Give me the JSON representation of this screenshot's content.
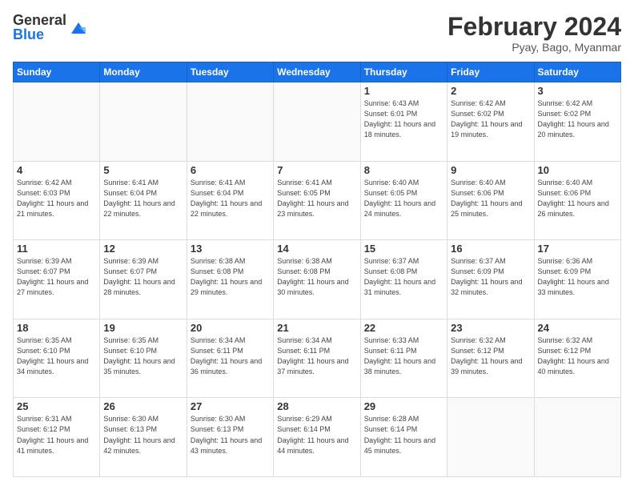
{
  "logo": {
    "general": "General",
    "blue": "Blue"
  },
  "header": {
    "month": "February 2024",
    "location": "Pyay, Bago, Myanmar"
  },
  "weekdays": [
    "Sunday",
    "Monday",
    "Tuesday",
    "Wednesday",
    "Thursday",
    "Friday",
    "Saturday"
  ],
  "weeks": [
    [
      {
        "day": "",
        "info": ""
      },
      {
        "day": "",
        "info": ""
      },
      {
        "day": "",
        "info": ""
      },
      {
        "day": "",
        "info": ""
      },
      {
        "day": "1",
        "info": "Sunrise: 6:43 AM\nSunset: 6:01 PM\nDaylight: 11 hours\nand 18 minutes."
      },
      {
        "day": "2",
        "info": "Sunrise: 6:42 AM\nSunset: 6:02 PM\nDaylight: 11 hours\nand 19 minutes."
      },
      {
        "day": "3",
        "info": "Sunrise: 6:42 AM\nSunset: 6:02 PM\nDaylight: 11 hours\nand 20 minutes."
      }
    ],
    [
      {
        "day": "4",
        "info": "Sunrise: 6:42 AM\nSunset: 6:03 PM\nDaylight: 11 hours\nand 21 minutes."
      },
      {
        "day": "5",
        "info": "Sunrise: 6:41 AM\nSunset: 6:04 PM\nDaylight: 11 hours\nand 22 minutes."
      },
      {
        "day": "6",
        "info": "Sunrise: 6:41 AM\nSunset: 6:04 PM\nDaylight: 11 hours\nand 22 minutes."
      },
      {
        "day": "7",
        "info": "Sunrise: 6:41 AM\nSunset: 6:05 PM\nDaylight: 11 hours\nand 23 minutes."
      },
      {
        "day": "8",
        "info": "Sunrise: 6:40 AM\nSunset: 6:05 PM\nDaylight: 11 hours\nand 24 minutes."
      },
      {
        "day": "9",
        "info": "Sunrise: 6:40 AM\nSunset: 6:06 PM\nDaylight: 11 hours\nand 25 minutes."
      },
      {
        "day": "10",
        "info": "Sunrise: 6:40 AM\nSunset: 6:06 PM\nDaylight: 11 hours\nand 26 minutes."
      }
    ],
    [
      {
        "day": "11",
        "info": "Sunrise: 6:39 AM\nSunset: 6:07 PM\nDaylight: 11 hours\nand 27 minutes."
      },
      {
        "day": "12",
        "info": "Sunrise: 6:39 AM\nSunset: 6:07 PM\nDaylight: 11 hours\nand 28 minutes."
      },
      {
        "day": "13",
        "info": "Sunrise: 6:38 AM\nSunset: 6:08 PM\nDaylight: 11 hours\nand 29 minutes."
      },
      {
        "day": "14",
        "info": "Sunrise: 6:38 AM\nSunset: 6:08 PM\nDaylight: 11 hours\nand 30 minutes."
      },
      {
        "day": "15",
        "info": "Sunrise: 6:37 AM\nSunset: 6:08 PM\nDaylight: 11 hours\nand 31 minutes."
      },
      {
        "day": "16",
        "info": "Sunrise: 6:37 AM\nSunset: 6:09 PM\nDaylight: 11 hours\nand 32 minutes."
      },
      {
        "day": "17",
        "info": "Sunrise: 6:36 AM\nSunset: 6:09 PM\nDaylight: 11 hours\nand 33 minutes."
      }
    ],
    [
      {
        "day": "18",
        "info": "Sunrise: 6:35 AM\nSunset: 6:10 PM\nDaylight: 11 hours\nand 34 minutes."
      },
      {
        "day": "19",
        "info": "Sunrise: 6:35 AM\nSunset: 6:10 PM\nDaylight: 11 hours\nand 35 minutes."
      },
      {
        "day": "20",
        "info": "Sunrise: 6:34 AM\nSunset: 6:11 PM\nDaylight: 11 hours\nand 36 minutes."
      },
      {
        "day": "21",
        "info": "Sunrise: 6:34 AM\nSunset: 6:11 PM\nDaylight: 11 hours\nand 37 minutes."
      },
      {
        "day": "22",
        "info": "Sunrise: 6:33 AM\nSunset: 6:11 PM\nDaylight: 11 hours\nand 38 minutes."
      },
      {
        "day": "23",
        "info": "Sunrise: 6:32 AM\nSunset: 6:12 PM\nDaylight: 11 hours\nand 39 minutes."
      },
      {
        "day": "24",
        "info": "Sunrise: 6:32 AM\nSunset: 6:12 PM\nDaylight: 11 hours\nand 40 minutes."
      }
    ],
    [
      {
        "day": "25",
        "info": "Sunrise: 6:31 AM\nSunset: 6:12 PM\nDaylight: 11 hours\nand 41 minutes."
      },
      {
        "day": "26",
        "info": "Sunrise: 6:30 AM\nSunset: 6:13 PM\nDaylight: 11 hours\nand 42 minutes."
      },
      {
        "day": "27",
        "info": "Sunrise: 6:30 AM\nSunset: 6:13 PM\nDaylight: 11 hours\nand 43 minutes."
      },
      {
        "day": "28",
        "info": "Sunrise: 6:29 AM\nSunset: 6:14 PM\nDaylight: 11 hours\nand 44 minutes."
      },
      {
        "day": "29",
        "info": "Sunrise: 6:28 AM\nSunset: 6:14 PM\nDaylight: 11 hours\nand 45 minutes."
      },
      {
        "day": "",
        "info": ""
      },
      {
        "day": "",
        "info": ""
      }
    ]
  ]
}
